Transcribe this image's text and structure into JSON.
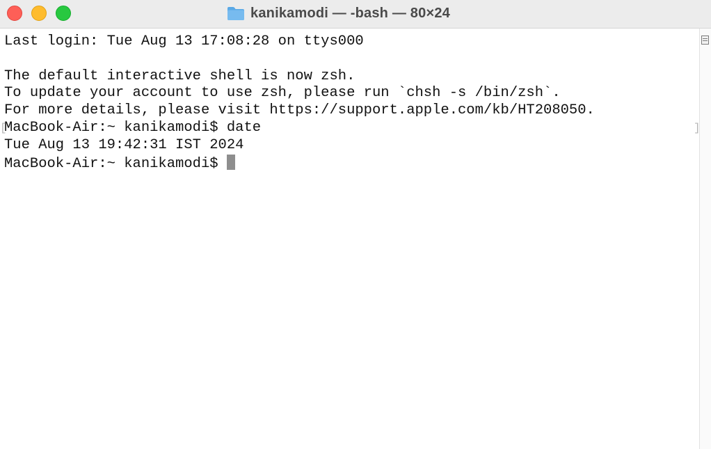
{
  "window": {
    "title": "kanikamodi — -bash — 80×24",
    "folder_icon": "folder-icon"
  },
  "terminal": {
    "lines": [
      "Last login: Tue Aug 13 17:08:28 on ttys000",
      "",
      "The default interactive shell is now zsh.",
      "To update your account to use zsh, please run `chsh -s /bin/zsh`.",
      "For more details, please visit https://support.apple.com/kb/HT208050.",
      "MacBook-Air:~ kanikamodi$ date",
      "Tue Aug 13 19:42:31 IST 2024"
    ],
    "prompt": "MacBook-Air:~ kanikamodi$ "
  },
  "colors": {
    "close": "#fe5f57",
    "minimize": "#febc2e",
    "zoom": "#28c840",
    "cursor": "#8e8e8e"
  }
}
